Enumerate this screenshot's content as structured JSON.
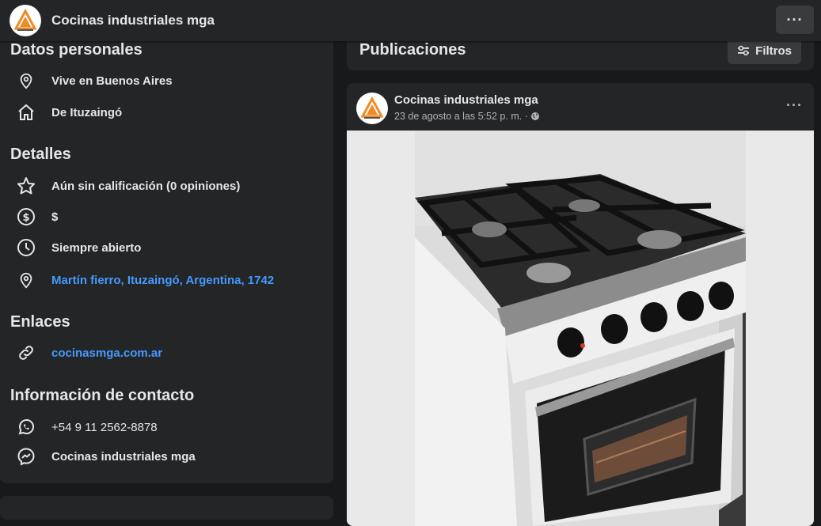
{
  "header": {
    "page_name": "Cocinas industriales mga",
    "more_icon": "ellipsis-icon"
  },
  "left": {
    "personal": {
      "title": "Datos personales",
      "lives": "Vive en Buenos Aires",
      "from": "De Ituzaingó"
    },
    "details": {
      "title": "Detalles",
      "rating": "Aún sin calificación (0 opiniones)",
      "price": "$",
      "hours": "Siempre abierto",
      "address": "Martín fierro, Ituzaingó, Argentina, 1742"
    },
    "links": {
      "title": "Enlaces",
      "website": "cocinasmga.com.ar"
    },
    "contact": {
      "title": "Información de contacto",
      "whatsapp": "+54 9 11 2562-8878",
      "messenger": "Cocinas industriales mga"
    }
  },
  "publications": {
    "title": "Publicaciones",
    "filters_label": "Filtros"
  },
  "post": {
    "author": "Cocinas industriales mga",
    "date": "23 de agosto a las 5:52 p. m. ·",
    "privacy_icon": "globe-icon"
  },
  "colors": {
    "background": "#18191a",
    "card": "#242526",
    "button": "#3a3b3c",
    "text_primary": "#e4e6eb",
    "text_secondary": "#b0b3b8",
    "link": "#4599ff",
    "logo_orange": "#f08a24"
  }
}
